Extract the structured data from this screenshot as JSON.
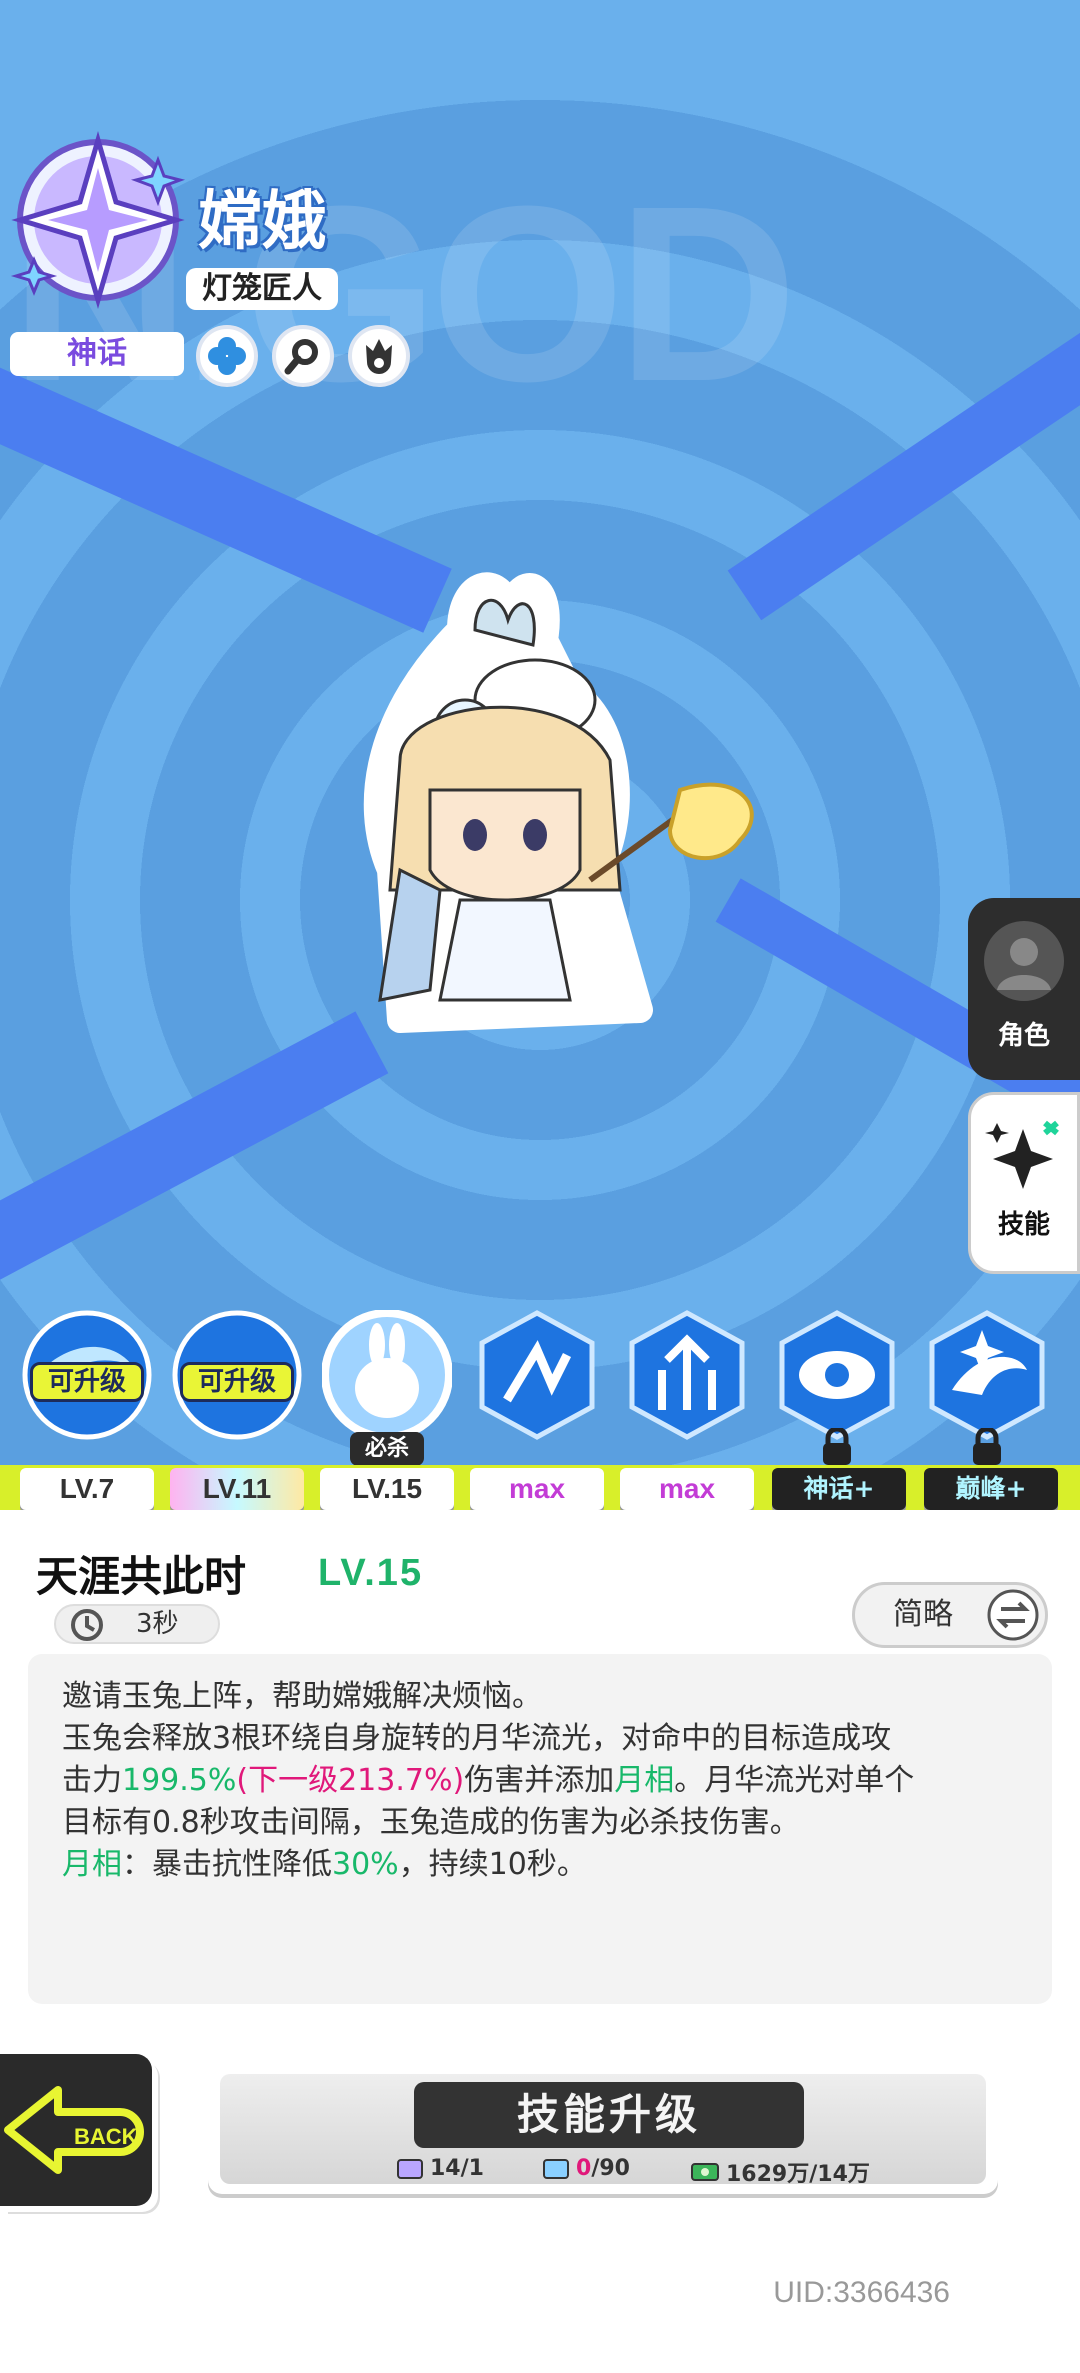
{
  "hero": {
    "name": "嫦娥",
    "title": "灯笼匠人",
    "rarity": "神话",
    "background_text": "N.GOD",
    "tag_icons": [
      "clover-tag-icon",
      "search-tag-icon",
      "flame-tag-icon"
    ]
  },
  "side_tabs": {
    "character": "角色",
    "skills": "技能"
  },
  "skills": [
    {
      "badge": "可升级",
      "level": "LV.7"
    },
    {
      "badge": "可升级",
      "level": "LV.11"
    },
    {
      "badge": "必杀",
      "level": "LV.15"
    },
    {
      "badge": "",
      "level": "max"
    },
    {
      "badge": "",
      "level": "max"
    },
    {
      "badge": "",
      "level": "神话+"
    },
    {
      "badge": "",
      "level": "巅峰+"
    }
  ],
  "detail": {
    "name": "天涯共此时",
    "level": "LV.15",
    "cooldown": "3秒",
    "brief_button": "简略",
    "desc": {
      "line1": "邀请玉兔上阵，帮助嫦娥解决烦恼。",
      "line2a": "玉兔会释放3根环绕自身旋转的月华流光，对命中的目标造成攻",
      "line3a": "击力",
      "line3b": "199.5%",
      "line3c": "(下一级213.7%)",
      "line3d": "伤害并添加",
      "line3e": "月相",
      "line3f": "。月华流光对单个",
      "line4": "目标有0.8秒攻击间隔，玉兔造成的伤害为必杀技伤害。",
      "line5a": "月相",
      "line5b": "：暴击抗性降低",
      "line5c": "30%",
      "line5d": "，持续10秒。"
    }
  },
  "back_label": "BACK",
  "upgrade": {
    "label": "技能升级",
    "cost1": "14/1",
    "cost2_have": "0",
    "cost2_need": "/90",
    "cost3": "1629万/14万"
  },
  "uid": "UID:3366436",
  "colors": {
    "accent_green": "#1fb36a",
    "next_level_pink": "#e0187a",
    "rarity_purple": "#7a4bdf",
    "level_bar_lime": "#d8ef2a"
  }
}
